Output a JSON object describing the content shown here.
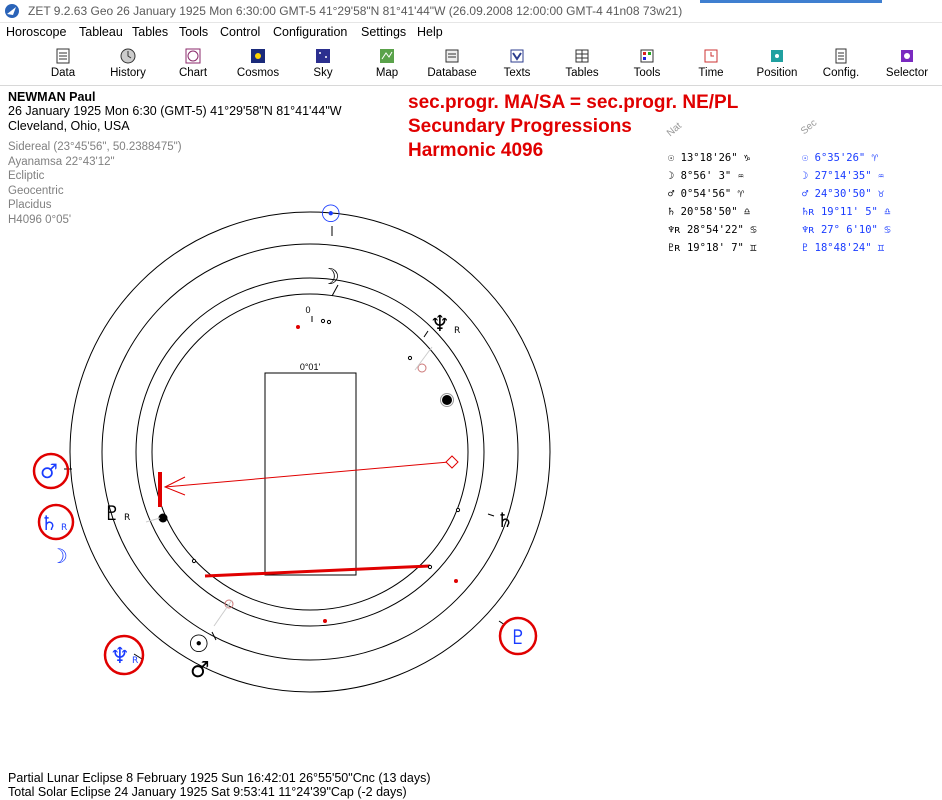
{
  "window": {
    "title": "ZET 9.2.63 Geo   26 January 1925  Mon   6:30:00 GMT-5 41°29'58\"N  81°41'44\"W  (26.09.2008  12:00:00 GMT-4 41n08 73w21)"
  },
  "menu": [
    "Horoscope",
    "Tableau",
    "Tables",
    "Tools",
    "Control",
    "Configuration",
    "Settings",
    "Help"
  ],
  "toolbar": [
    "Data",
    "History",
    "Chart",
    "Cosmos",
    "Sky",
    "Map",
    "Database",
    "Texts",
    "Tables",
    "Tools",
    "Time",
    "Position",
    "Config.",
    "Selector"
  ],
  "person": {
    "name": "NEWMAN Paul",
    "datetime": "26 January 1925  Mon   6:30 (GMT-5) 41°29'58\"N  81°41'44\"W",
    "place": "Cleveland, Ohio, USA"
  },
  "settings": [
    "Sidereal (23°45'56\", 50.2388475\")",
    "Ayanamsa 22°43'12\"",
    "Ecliptic",
    "Geocentric",
    "Placidus",
    "H4096   0°05'"
  ],
  "headline": [
    "sec.progr. MA/SA = sec.progr. NE/PL",
    "Secundary Progressions",
    "Harmonic 4096"
  ],
  "column_heads": {
    "natal": "Nat",
    "secondary": "Sec"
  },
  "natal_positions": [
    {
      "glyph": "☉",
      "value": "13°18'26\"",
      "sign": "♑"
    },
    {
      "glyph": "☽",
      "value": " 8°56' 3\"",
      "sign": "♒"
    },
    {
      "glyph": "♂",
      "value": " 0°54'56\"",
      "sign": "♈"
    },
    {
      "glyph": "♄",
      "value": "20°58'50\"",
      "sign": "♎"
    },
    {
      "glyph": "♆ʀ",
      "value": "28°54'22\"",
      "sign": "♋"
    },
    {
      "glyph": "♇ʀ",
      "value": "19°18' 7\"",
      "sign": "♊"
    }
  ],
  "sec_positions": [
    {
      "glyph": "☉",
      "value": " 6°35'26\"",
      "sign": "♈"
    },
    {
      "glyph": "☽",
      "value": "27°14'35\"",
      "sign": "♒"
    },
    {
      "glyph": "♂",
      "value": "24°30'50\"",
      "sign": "♉"
    },
    {
      "glyph": "♄ʀ",
      "value": "19°11' 5\"",
      "sign": "♎"
    },
    {
      "glyph": "♆ʀ",
      "value": "27° 6'10\"",
      "sign": "♋"
    },
    {
      "glyph": "♇",
      "value": "18°48'24\"",
      "sign": "♊"
    }
  ],
  "chart": {
    "zero_label": "0",
    "box_label": "0°01'",
    "retro_mark": "R",
    "glyphs": {
      "sun": "☉",
      "moon": "☽",
      "mars": "♂",
      "saturn": "♄",
      "neptune": "♆",
      "pluto": "♇"
    }
  },
  "footer": [
    "Partial Lunar Eclipse 8 February 1925 Sun 16:42:01 26°55'50\"Cnc (13 days)",
    "Total Solar Eclipse 24 January 1925 Sat  9:53:41 11°24'39\"Cap (-2 days)"
  ],
  "colors": {
    "headline": "#e00000",
    "secondary": "#1a3cff",
    "highlight_ring": "#e00000"
  }
}
